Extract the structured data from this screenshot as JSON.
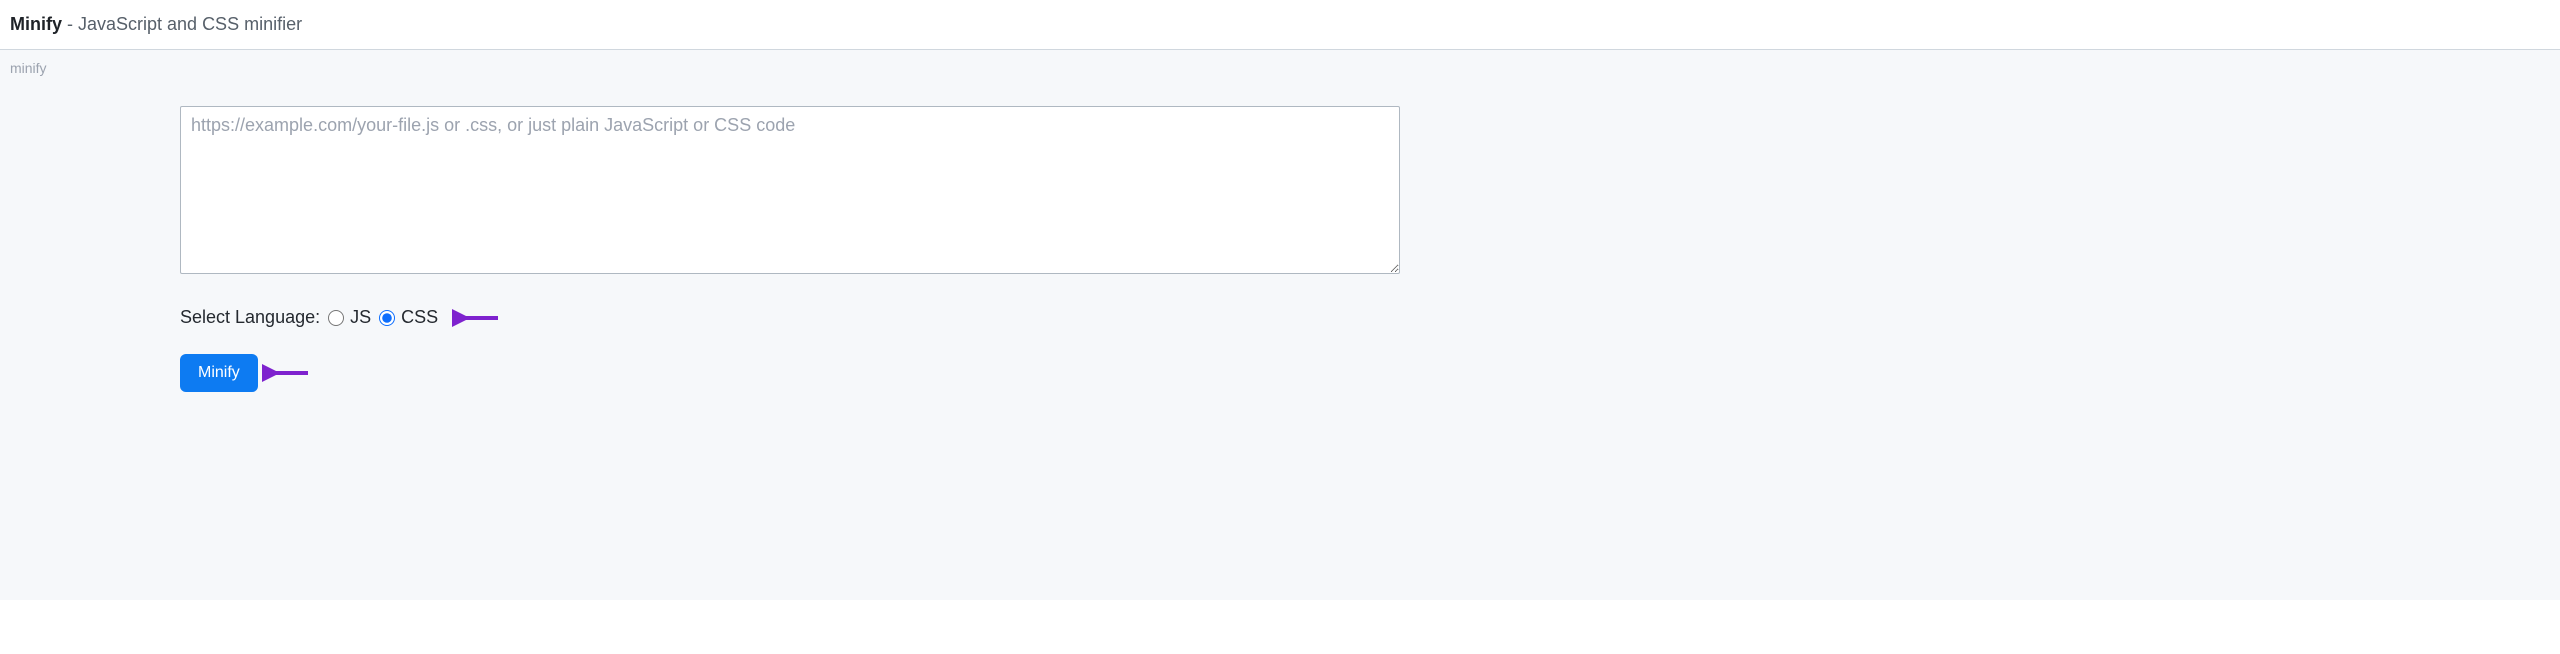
{
  "header": {
    "title_bold": "Minify",
    "title_rest": " - JavaScript and CSS minifier"
  },
  "breadcrumb": {
    "label": "minify"
  },
  "form": {
    "input_placeholder": "https://example.com/your-file.js or .css, or just plain JavaScript or CSS code",
    "input_value": "",
    "select_label": "Select Language:",
    "options": {
      "js": "JS",
      "css": "CSS"
    },
    "selected": "css",
    "button_label": "Minify"
  },
  "colors": {
    "primary": "#0d7bf2",
    "arrow": "#7e22ce"
  }
}
